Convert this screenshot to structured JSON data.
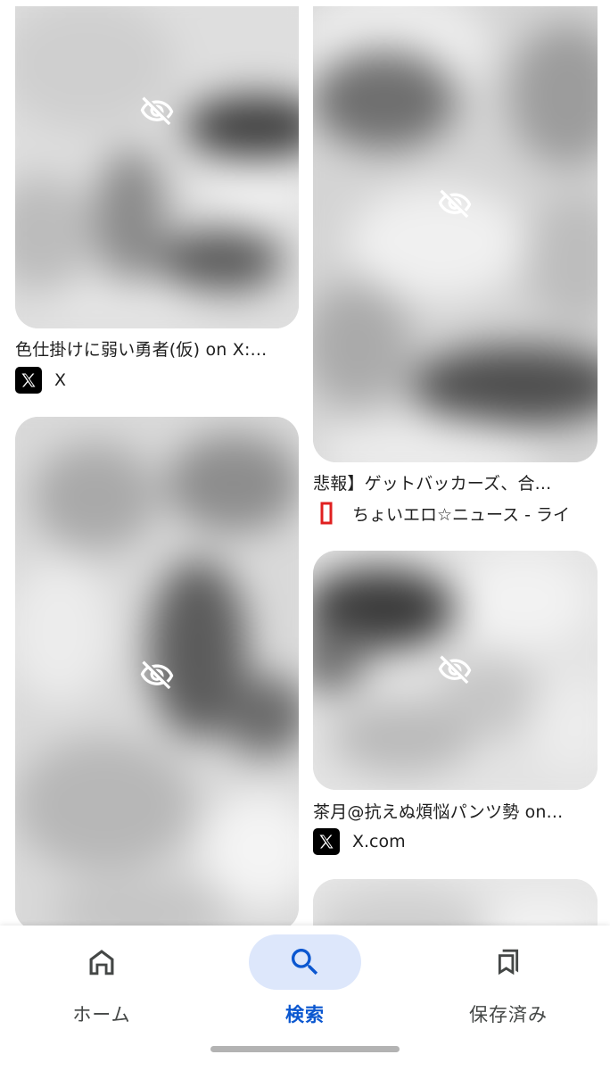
{
  "results": [
    {
      "caption": "色仕掛けに弱い勇者(仮) on X:...",
      "source_name": "X",
      "source_icon": "x-logo-icon"
    },
    {
      "caption": "悲報】ゲットバッカーズ、合...",
      "source_name": "ちょいエロ☆ニュース - ライ",
      "source_icon": "chyoi-ero-news-icon"
    },
    {
      "caption": "茶月@抗えぬ煩悩パンツ勢 on...",
      "source_name": "X.com",
      "source_icon": "x-logo-icon"
    }
  ],
  "hidden_image_icon": "eye-off-icon",
  "bottom_nav": {
    "items": [
      {
        "label": "ホーム",
        "icon": "home-icon",
        "active": false
      },
      {
        "label": "検索",
        "icon": "search-icon",
        "active": true
      },
      {
        "label": "保存済み",
        "icon": "bookmarks-icon",
        "active": false
      }
    ]
  },
  "colors": {
    "accent": "#0b57d0",
    "active_pill": "#dde7fb",
    "text": "#1f1f1f",
    "nav_text": "#444746"
  }
}
